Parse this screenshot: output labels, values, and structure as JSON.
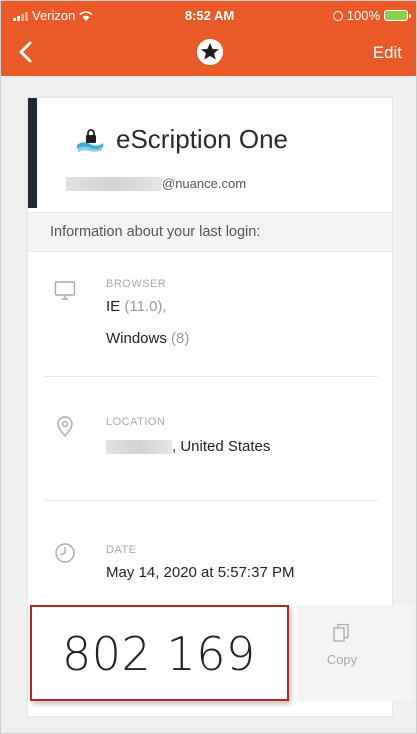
{
  "status_bar": {
    "carrier": "Verizon",
    "time": "8:52 AM",
    "battery": "100%"
  },
  "nav": {
    "edit_label": "Edit",
    "back_icon": "chevron-left-icon",
    "logo_icon": "star-shield-icon"
  },
  "app": {
    "name": "eScription One",
    "email_domain": "@nuance.com",
    "icon": "lock-wave-icon"
  },
  "info_heading": "Information about your last login:",
  "browser": {
    "label": "BROWSER",
    "name": "IE",
    "version": "(11.0),",
    "os": "Windows",
    "os_version": "(8)"
  },
  "location": {
    "label": "LOCATION",
    "value": ", United States"
  },
  "date": {
    "label": "DATE",
    "value": "May 14, 2020 at 5:57:37 PM"
  },
  "code": "802 169",
  "copy_label": "Copy",
  "colors": {
    "header": "#ea5a28",
    "highlight_border": "#b3281f",
    "accent": "#22282f"
  }
}
